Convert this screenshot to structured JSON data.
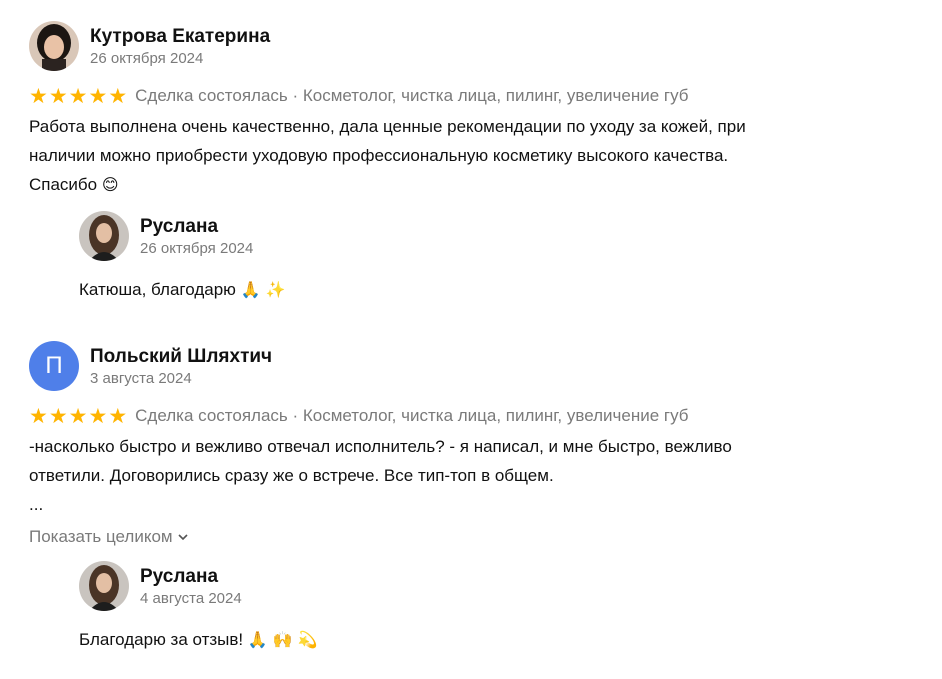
{
  "reviews": [
    {
      "author": "Кутрова Екатерина",
      "date": "26 октября 2024",
      "stars": 5,
      "deal": "Сделка состоялась · Косметолог, чистка лица, пилинг, увеличение губ",
      "text": "Работа выполнена очень качественно, дала ценные рекомендации по уходу за кожей, при\nналичии можно приобрести уходовую профессиональную косметику высокого качества.\nСпасибо",
      "text_emoji": "😊",
      "reply": {
        "author": "Руслана",
        "date": "26 октября 2024",
        "text": "Катюша, благодарю",
        "emoji": "🙏 ✨"
      }
    },
    {
      "author": "Польский Шляхтич",
      "avatar_letter": "П",
      "date": "3 августа 2024",
      "stars": 5,
      "deal": "Сделка состоялась · Косметолог, чистка лица, пилинг, увеличение губ",
      "text": "-насколько быстро и вежливо отвечал исполнитель? - я написал, и мне быстро, вежливо\nответили. Договорились сразу же о встрече. Все тип-топ в общем.\n...",
      "show_more": "Показать целиком",
      "reply": {
        "author": "Руслана",
        "date": "4 августа 2024",
        "text": "Благодарю за отзыв!",
        "emoji": "🙏 🙌 💫"
      }
    }
  ],
  "colors": {
    "star": "#ffb400",
    "muted": "#7a7a7a",
    "letter_avatar": "#4f7fe9"
  }
}
